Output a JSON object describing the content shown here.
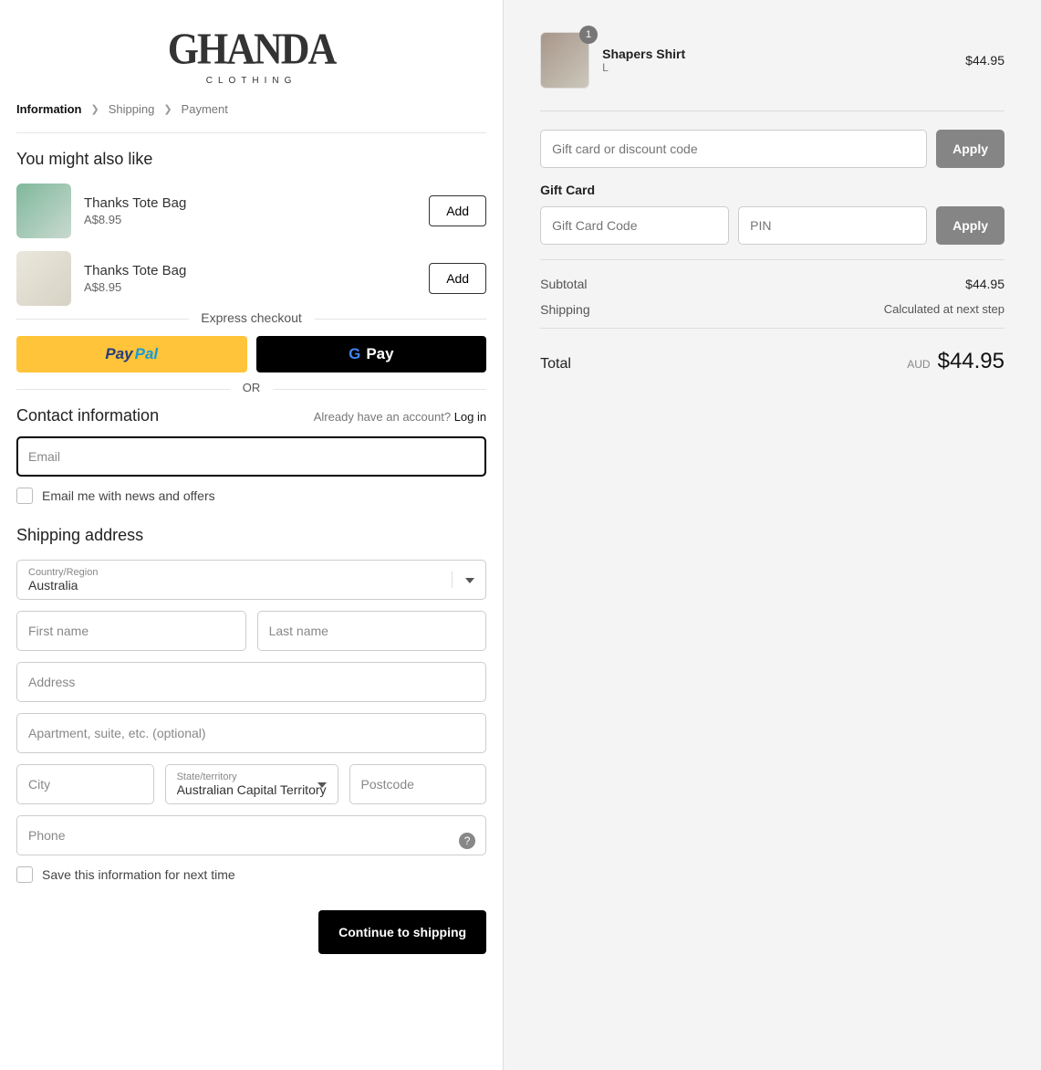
{
  "logo": {
    "main": "GHANDA",
    "sub": "CLOTHING"
  },
  "breadcrumb": {
    "information": "Information",
    "shipping": "Shipping",
    "payment": "Payment"
  },
  "upsell": {
    "heading": "You might also like",
    "items": [
      {
        "name": "Thanks Tote Bag",
        "price": "A$8.95",
        "btn": "Add"
      },
      {
        "name": "Thanks Tote Bag",
        "price": "A$8.95",
        "btn": "Add"
      }
    ]
  },
  "express": {
    "label": "Express checkout",
    "or": "OR"
  },
  "contact": {
    "heading": "Contact information",
    "hint": "Already have an account? ",
    "login": "Log in",
    "email_ph": "Email",
    "newsletter": "Email me with news and offers"
  },
  "shipping": {
    "heading": "Shipping address",
    "country_lab": "Country/Region",
    "country_val": "Australia",
    "first_ph": "First name",
    "last_ph": "Last name",
    "addr_ph": "Address",
    "apt_ph": "Apartment, suite, etc. (optional)",
    "city_ph": "City",
    "state_lab": "State/territory",
    "state_val": "Australian Capital Territory",
    "post_ph": "Postcode",
    "phone_ph": "Phone",
    "save": "Save this information for next time",
    "continue": "Continue to shipping"
  },
  "cart": {
    "item": {
      "qty": "1",
      "name": "Shapers Shirt",
      "variant": "L",
      "price": "$44.95"
    },
    "discount_ph": "Gift card or discount code",
    "apply": "Apply",
    "gc_label": "Gift Card",
    "gc_code_ph": "Gift Card Code",
    "gc_pin_ph": "PIN",
    "subtotal_lab": "Subtotal",
    "subtotal_val": "$44.95",
    "ship_lab": "Shipping",
    "ship_val": "Calculated at next step",
    "total_lab": "Total",
    "total_cur": "AUD",
    "total_val": "$44.95"
  }
}
